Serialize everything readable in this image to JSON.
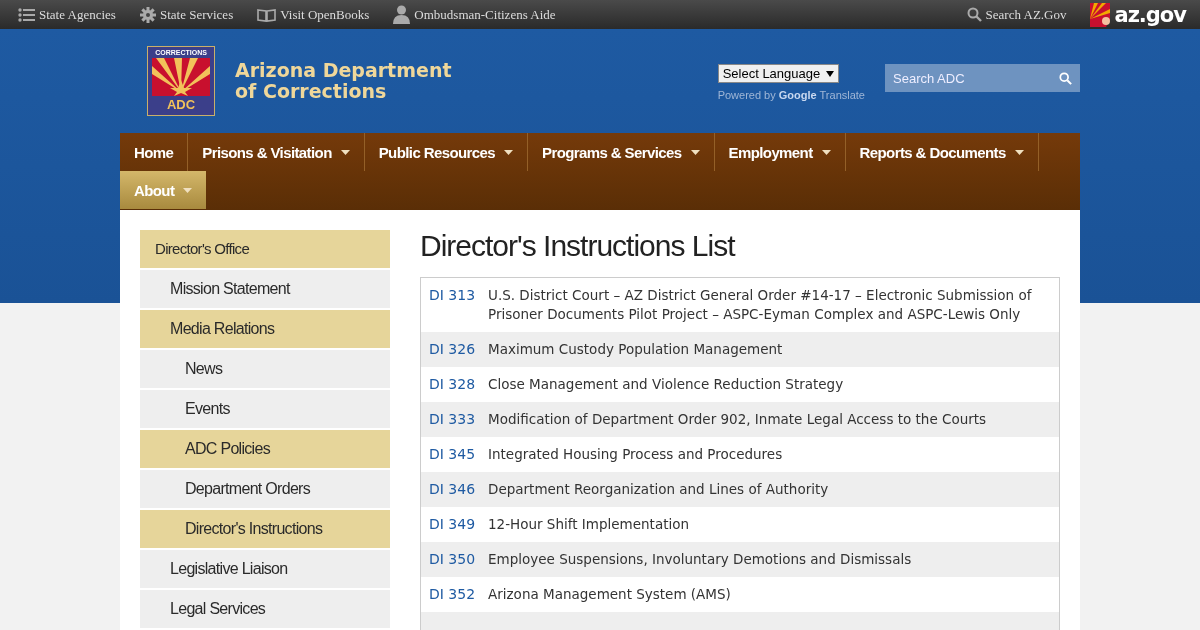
{
  "top_bar": {
    "links": [
      {
        "label": "State Agencies"
      },
      {
        "label": "State Services"
      },
      {
        "label": "Visit OpenBooks"
      },
      {
        "label": "Ombudsman-Citizens Aide"
      }
    ],
    "search_label": "Search AZ.Gov",
    "brand": "az.gov"
  },
  "header": {
    "logo_top": "CORRECTIONS",
    "logo_badge": "ADC",
    "site_title_lines": [
      "Arizona Department",
      "of Corrections"
    ],
    "language_select": "Select Language",
    "translate_prefix": "Powered by",
    "translate_brand": "Google",
    "translate_suffix": "Translate",
    "search": {
      "placeholder": "Search ADC"
    }
  },
  "nav": [
    {
      "label": "Home",
      "dropdown": false,
      "selected": false
    },
    {
      "label": "Prisons & Visitation",
      "dropdown": true,
      "selected": false
    },
    {
      "label": "Public Resources",
      "dropdown": true,
      "selected": false
    },
    {
      "label": "Programs & Services",
      "dropdown": true,
      "selected": false
    },
    {
      "label": "Employment",
      "dropdown": true,
      "selected": false
    },
    {
      "label": "Reports & Documents",
      "dropdown": true,
      "selected": false
    },
    {
      "label": "About",
      "dropdown": true,
      "selected": true
    }
  ],
  "sidebar": {
    "items": [
      {
        "label": "Director's Office",
        "selected": true,
        "children": [
          {
            "label": "Mission Statement",
            "selected": false
          },
          {
            "label": "Media Relations",
            "selected": true,
            "children": [
              {
                "label": "News",
                "selected": false
              },
              {
                "label": "Events",
                "selected": false
              },
              {
                "label": "ADC Policies",
                "selected": true
              },
              {
                "label": "Department Orders",
                "selected": false
              },
              {
                "label": "Director's Instructions",
                "selected": true
              }
            ]
          },
          {
            "label": "Legislative Liaison",
            "selected": false
          },
          {
            "label": "Legal Services",
            "selected": false
          }
        ]
      }
    ]
  },
  "page_title": "Director's Instructions List",
  "table": {
    "rows": [
      {
        "number": "DI 313",
        "title": "U.S. District Court – AZ District General Order #14-17 – Electronic Submission of Prisoner Documents Pilot Project – ASPC-Eyman Complex and ASPC-Lewis Only"
      },
      {
        "number": "DI 326",
        "title": "Maximum Custody Population Management"
      },
      {
        "number": "DI 328",
        "title": "Close Management and Violence Reduction Strategy"
      },
      {
        "number": "DI 333",
        "title": "Modification of Department Order 902, Inmate Legal Access to the Courts"
      },
      {
        "number": "DI 345",
        "title": "Integrated Housing Process and Procedures"
      },
      {
        "number": "DI 346",
        "title": "Department Reorganization and Lines of Authority"
      },
      {
        "number": "DI 349",
        "title": "12-Hour Shift Implementation"
      },
      {
        "number": "DI 350",
        "title": "Employee Suspensions, Involuntary Demotions and Dismissals"
      },
      {
        "number": "DI 352",
        "title": "Arizona Management System (AMS)"
      }
    ]
  }
}
